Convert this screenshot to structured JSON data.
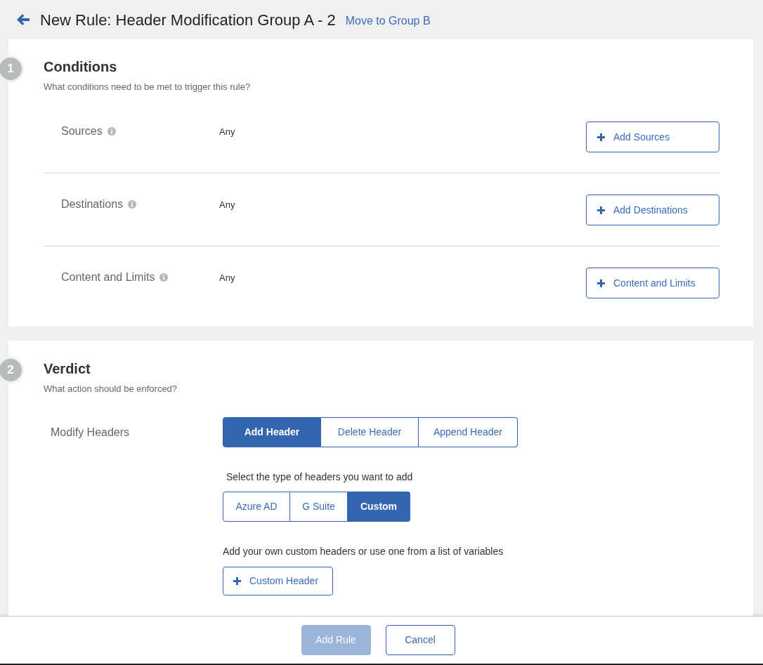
{
  "header": {
    "title": "New Rule: Header Modification Group A - 2",
    "link": "Move to Group B"
  },
  "conditions": {
    "step": "1",
    "title": "Conditions",
    "subtitle": "What conditions need to be met to trigger this rule?",
    "rows": [
      {
        "label": "Sources",
        "value": "Any",
        "button": "Add Sources"
      },
      {
        "label": "Destinations",
        "value": "Any",
        "button": "Add Destinations"
      },
      {
        "label": "Content and Limits",
        "value": "Any",
        "button": "Content and Limits"
      }
    ]
  },
  "verdict": {
    "step": "2",
    "title": "Verdict",
    "subtitle": "What action should be enforced?",
    "field_label": "Modify Headers",
    "actions": [
      {
        "label": "Add Header",
        "selected": true
      },
      {
        "label": "Delete Header",
        "selected": false
      },
      {
        "label": "Append Header",
        "selected": false
      }
    ],
    "type_prompt": "Select the type of headers you want to add",
    "header_types": [
      {
        "label": "Azure AD",
        "selected": false
      },
      {
        "label": "G Suite",
        "selected": false
      },
      {
        "label": "Custom",
        "selected": true
      }
    ],
    "custom_prompt": "Add your own custom headers or use one from a list of variables",
    "custom_button": "Custom Header"
  },
  "footer": {
    "buttons": [
      {
        "label": "Add Rule",
        "kind": "primary",
        "disabled": true
      },
      {
        "label": "Cancel",
        "kind": "secondary",
        "disabled": false
      }
    ]
  }
}
